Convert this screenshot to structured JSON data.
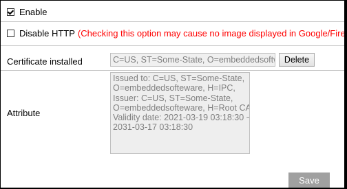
{
  "enable": {
    "label": "Enable",
    "checked": true
  },
  "disable_http": {
    "label": "Disable HTTP",
    "warning": "(Checking this option may cause no image displayed in Google/Firefox!)",
    "checked": false,
    "warning_color": "#ff0000"
  },
  "certificate": {
    "label": "Certificate installed",
    "value": "C=US, ST=Some-State, O=embeddedsoftware, H=IPC",
    "delete_label": "Delete"
  },
  "attribute": {
    "label": "Attribute",
    "lines": [
      "Issued to: C=US, ST=Some-State,",
      "O=embeddedsofteware, H=IPC,",
      "Issuer: C=US, ST=Some-State,",
      "O=embeddedsofteware, H=Root CA,",
      "Validity date: 2021-03-19 03:18:30 ~",
      "2031-03-17 03:18:30"
    ]
  },
  "save_label": "Save",
  "colors": {
    "save_button_bg": "#a0a0a0",
    "readonly_field_bg": "#eeeeee",
    "readonly_text": "#7f7f7f"
  }
}
